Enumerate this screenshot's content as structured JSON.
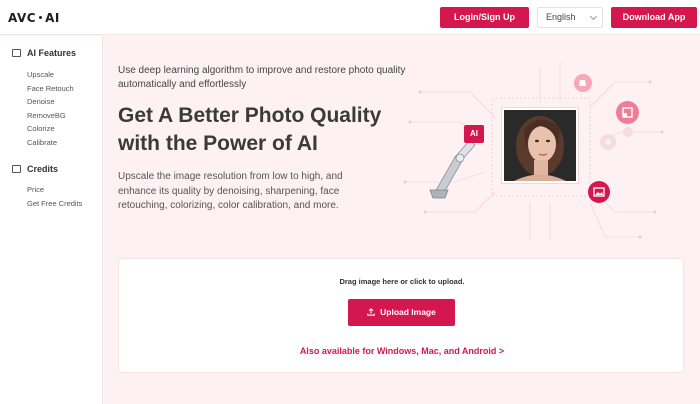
{
  "header": {
    "logo_left": "AVC",
    "logo_right": "AI",
    "login_label": "Login/Sign Up",
    "language": "English",
    "download_label": "Download App"
  },
  "sidebar": {
    "sections": [
      {
        "label": "AI Features",
        "items": [
          "Upscale",
          "Face Retouch",
          "Denoise",
          "RemoveBG",
          "Colorize",
          "Calibrate"
        ]
      },
      {
        "label": "Credits",
        "items": [
          "Price",
          "Get Free Credits"
        ]
      }
    ]
  },
  "hero": {
    "subtitle": "Use deep learning algorithm to improve and restore photo quality automatically and effortlessly",
    "title": "Get A Better Photo Quality with the Power of AI",
    "description": "Upscale the image resolution from low to high, and enhance its quality by denoising, sharpening, face retouching, colorizing, color calibration, and more.",
    "ai_badge": "AI"
  },
  "upload": {
    "drag_text": "Drag image here or click to upload.",
    "button_label": "Upload Image",
    "platforms_link": "Also available for Windows, Mac, and Android >"
  },
  "colors": {
    "accent": "#d4174f",
    "background": "#fdf1f3",
    "accent_light": "#f47a96"
  },
  "icons": [
    "image-icon",
    "credits-icon",
    "upload-icon",
    "chevron-down-icon",
    "paint-bucket-icon",
    "resize-icon",
    "gear-icon",
    "photo-icon"
  ]
}
